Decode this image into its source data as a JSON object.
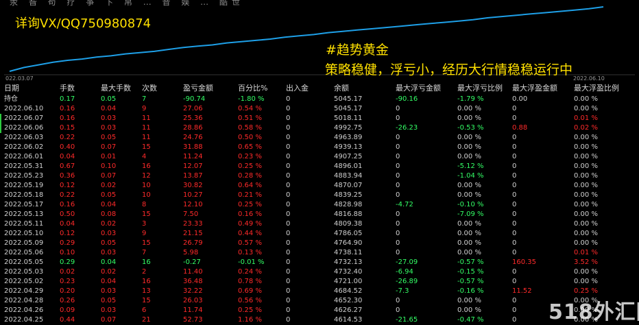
{
  "top_menu": "汞 昝 苟 疗 亊 卞 帛 … 音 娱 … 酷世",
  "overlay": {
    "promo": "详询VX/QQ750980874",
    "tag_line1": "#趋势黄金",
    "tag_line2": "策略稳健，浮亏小，经历大行情稳稳运行中"
  },
  "chart_data": {
    "type": "line",
    "title": "",
    "x_start_label": "022.03.07",
    "x_end_label": "2022.06.10",
    "line_color": "#1ea0e8",
    "series": [
      {
        "values": [
          0,
          6,
          10,
          14,
          17,
          19,
          22,
          24,
          27,
          29,
          31,
          34,
          37,
          39,
          41,
          44,
          46,
          48,
          50,
          53,
          55,
          57,
          60,
          62,
          64,
          66,
          68,
          70,
          72,
          74,
          76,
          78,
          80,
          83,
          85,
          87,
          89,
          91,
          93,
          95,
          97,
          100
        ]
      }
    ]
  },
  "colors": {
    "profit": "#ff2a2a",
    "loss": "#33ff66",
    "neutral": "#d0d0d0",
    "highlight": "#ffe000"
  },
  "table": {
    "headers": [
      "日期",
      "手数",
      "最大手数",
      "次数",
      "盈亏金额",
      "百分比%",
      "出入金",
      "余额",
      "最大浮亏金额",
      "最大浮亏比例",
      "最大浮盈金额",
      "最大浮盈比例"
    ],
    "rows": [
      {
        "cells": [
          "持仓",
          "0.17",
          "0.05",
          "7",
          "-90.74",
          "-1.80 %",
          "0",
          "5045.17",
          "-90.16",
          "-1.79 %",
          "0.00",
          "0.00 %"
        ],
        "colors": [
          "w",
          "g",
          "g",
          "g",
          "g",
          "g",
          "w",
          "w",
          "g",
          "g",
          "w",
          "w"
        ]
      },
      {
        "cells": [
          "2022.06.10",
          "0.16",
          "0.04",
          "9",
          "27.06",
          "0.54 %",
          "0",
          "5045.17",
          "0",
          "0.00 %",
          "0",
          "0.00 %"
        ],
        "colors": [
          "w",
          "r",
          "r",
          "r",
          "r",
          "r",
          "w",
          "w",
          "w",
          "w",
          "w",
          "w"
        ]
      },
      {
        "cells": [
          "2022.06.07",
          "0.16",
          "0.03",
          "11",
          "25.36",
          "0.51 %",
          "0",
          "5018.11",
          "0",
          "0.00 %",
          "0",
          "0.01 %"
        ],
        "colors": [
          "w",
          "r",
          "r",
          "r",
          "r",
          "r",
          "w",
          "w",
          "w",
          "w",
          "w",
          "r"
        ]
      },
      {
        "cells": [
          "2022.06.06",
          "0.15",
          "0.03",
          "11",
          "28.86",
          "0.58 %",
          "0",
          "4992.75",
          "-26.23",
          "-0.53 %",
          "0.88",
          "0.02 %"
        ],
        "colors": [
          "w",
          "r",
          "r",
          "r",
          "r",
          "r",
          "w",
          "w",
          "g",
          "g",
          "r",
          "r"
        ]
      },
      {
        "cells": [
          "2022.06.03",
          "0.22",
          "0.05",
          "11",
          "24.76",
          "0.50 %",
          "0",
          "4963.89",
          "0",
          "0.00 %",
          "0",
          "0.00 %"
        ],
        "colors": [
          "w",
          "r",
          "r",
          "r",
          "r",
          "r",
          "w",
          "w",
          "w",
          "w",
          "w",
          "w"
        ]
      },
      {
        "cells": [
          "2022.06.02",
          "0.40",
          "0.07",
          "15",
          "31.88",
          "0.65 %",
          "0",
          "4939.13",
          "0",
          "0.00 %",
          "0",
          "0.00 %"
        ],
        "colors": [
          "w",
          "r",
          "r",
          "r",
          "r",
          "r",
          "w",
          "w",
          "w",
          "w",
          "w",
          "w"
        ]
      },
      {
        "cells": [
          "2022.06.01",
          "0.04",
          "0.01",
          "4",
          "11.24",
          "0.23 %",
          "0",
          "4907.25",
          "0",
          "0.00 %",
          "0",
          "0.00 %"
        ],
        "colors": [
          "w",
          "r",
          "r",
          "r",
          "r",
          "r",
          "w",
          "w",
          "w",
          "w",
          "w",
          "w"
        ]
      },
      {
        "cells": [
          "2022.05.31",
          "0.67",
          "0.10",
          "16",
          "12.07",
          "0.25 %",
          "0",
          "4896.01",
          "0",
          "-5.12 %",
          "0",
          "0.00 %"
        ],
        "colors": [
          "w",
          "r",
          "r",
          "r",
          "r",
          "r",
          "w",
          "w",
          "w",
          "g",
          "w",
          "w"
        ]
      },
      {
        "cells": [
          "2022.05.23",
          "0.36",
          "0.07",
          "12",
          "13.87",
          "0.28 %",
          "0",
          "4883.94",
          "0",
          "-1.04 %",
          "0",
          "0.00 %"
        ],
        "colors": [
          "w",
          "r",
          "r",
          "r",
          "r",
          "r",
          "w",
          "w",
          "w",
          "g",
          "w",
          "w"
        ]
      },
      {
        "cells": [
          "2022.05.19",
          "0.12",
          "0.02",
          "10",
          "30.82",
          "0.64 %",
          "0",
          "4870.07",
          "0",
          "0.00 %",
          "0",
          "0.00 %"
        ],
        "colors": [
          "w",
          "r",
          "r",
          "r",
          "r",
          "r",
          "w",
          "w",
          "w",
          "w",
          "w",
          "w"
        ]
      },
      {
        "cells": [
          "2022.05.18",
          "0.22",
          "0.05",
          "10",
          "10.27",
          "0.21 %",
          "0",
          "4839.25",
          "0",
          "0.00 %",
          "0",
          "0.00 %"
        ],
        "colors": [
          "w",
          "r",
          "r",
          "r",
          "r",
          "r",
          "w",
          "w",
          "w",
          "w",
          "w",
          "w"
        ]
      },
      {
        "cells": [
          "2022.05.17",
          "0.16",
          "0.04",
          "8",
          "12.10",
          "0.25 %",
          "0",
          "4828.98",
          "-4.72",
          "-0.10 %",
          "0",
          "0.00 %"
        ],
        "colors": [
          "w",
          "r",
          "r",
          "r",
          "r",
          "r",
          "w",
          "w",
          "g",
          "g",
          "w",
          "w"
        ]
      },
      {
        "cells": [
          "2022.05.13",
          "0.50",
          "0.08",
          "15",
          "7.50",
          "0.16 %",
          "0",
          "4816.88",
          "0",
          "-7.09 %",
          "0",
          "0.00 %"
        ],
        "colors": [
          "w",
          "r",
          "r",
          "r",
          "r",
          "r",
          "w",
          "w",
          "w",
          "g",
          "w",
          "w"
        ]
      },
      {
        "cells": [
          "2022.05.11",
          "0.04",
          "0.02",
          "3",
          "23.33",
          "0.49 %",
          "0",
          "4809.38",
          "0",
          "0.00 %",
          "0",
          "0.00 %"
        ],
        "colors": [
          "w",
          "r",
          "r",
          "r",
          "r",
          "r",
          "w",
          "w",
          "w",
          "w",
          "w",
          "w"
        ]
      },
      {
        "cells": [
          "2022.05.10",
          "0.12",
          "0.03",
          "9",
          "21.15",
          "0.44 %",
          "0",
          "4786.05",
          "0",
          "0.00 %",
          "0",
          "0.00 %"
        ],
        "colors": [
          "w",
          "r",
          "r",
          "r",
          "r",
          "r",
          "w",
          "w",
          "w",
          "w",
          "w",
          "w"
        ]
      },
      {
        "cells": [
          "2022.05.09",
          "0.29",
          "0.05",
          "15",
          "26.79",
          "0.57 %",
          "0",
          "4764.90",
          "0",
          "0.00 %",
          "0",
          "0.00 %"
        ],
        "colors": [
          "w",
          "r",
          "r",
          "r",
          "r",
          "r",
          "w",
          "w",
          "w",
          "w",
          "w",
          "w"
        ]
      },
      {
        "cells": [
          "2022.05.06",
          "0.10",
          "0.03",
          "7",
          "5.98",
          "0.13 %",
          "0",
          "4738.11",
          "0",
          "0.00 %",
          "0",
          "0.01 %"
        ],
        "colors": [
          "w",
          "r",
          "r",
          "r",
          "r",
          "r",
          "w",
          "w",
          "w",
          "w",
          "w",
          "r"
        ]
      },
      {
        "cells": [
          "2022.05.05",
          "0.29",
          "0.04",
          "16",
          "-0.27",
          "-0.01 %",
          "0",
          "4732.13",
          "-27.09",
          "-0.57 %",
          "160.35",
          "3.52 %"
        ],
        "colors": [
          "w",
          "g",
          "g",
          "g",
          "g",
          "g",
          "w",
          "w",
          "g",
          "g",
          "r",
          "r"
        ]
      },
      {
        "cells": [
          "2022.05.03",
          "0.02",
          "0.02",
          "2",
          "11.40",
          "0.24 %",
          "0",
          "4732.40",
          "-6.94",
          "-0.15 %",
          "0",
          "0.00 %"
        ],
        "colors": [
          "w",
          "r",
          "r",
          "r",
          "r",
          "r",
          "w",
          "w",
          "g",
          "g",
          "w",
          "w"
        ]
      },
      {
        "cells": [
          "2022.05.02",
          "0.23",
          "0.04",
          "16",
          "36.48",
          "0.78 %",
          "0",
          "4721.00",
          "-26.89",
          "-0.57 %",
          "0",
          "0.00 %"
        ],
        "colors": [
          "w",
          "r",
          "r",
          "r",
          "r",
          "r",
          "w",
          "w",
          "g",
          "g",
          "w",
          "w"
        ]
      },
      {
        "cells": [
          "2022.04.29",
          "0.20",
          "0.03",
          "13",
          "32.22",
          "0.69 %",
          "0",
          "4684.52",
          "-7.3",
          "-0.16 %",
          "11.52",
          "0.25 %"
        ],
        "colors": [
          "w",
          "r",
          "r",
          "r",
          "r",
          "r",
          "w",
          "w",
          "g",
          "g",
          "r",
          "r"
        ]
      },
      {
        "cells": [
          "2022.04.28",
          "0.26",
          "0.05",
          "15",
          "26.03",
          "0.56 %",
          "0",
          "4652.30",
          "0",
          "0.00 %",
          "0",
          "0.00 %"
        ],
        "colors": [
          "w",
          "r",
          "r",
          "r",
          "r",
          "r",
          "w",
          "w",
          "w",
          "w",
          "w",
          "w"
        ]
      },
      {
        "cells": [
          "2022.04.26",
          "0.09",
          "0.03",
          "6",
          "11.74",
          "0.25 %",
          "0",
          "4626.27",
          "0",
          "0.00 %",
          "0",
          "0.00 %"
        ],
        "colors": [
          "w",
          "r",
          "r",
          "r",
          "r",
          "r",
          "w",
          "w",
          "w",
          "w",
          "w",
          "w"
        ]
      },
      {
        "cells": [
          "2022.04.25",
          "0.44",
          "0.07",
          "21",
          "52.73",
          "1.16 %",
          "0",
          "4614.53",
          "-21.65",
          "-0.47 %",
          "0",
          "0.00 %"
        ],
        "colors": [
          "w",
          "r",
          "r",
          "r",
          "r",
          "r",
          "w",
          "w",
          "g",
          "g",
          "w",
          "w"
        ]
      }
    ]
  },
  "watermark": "518外汇网"
}
